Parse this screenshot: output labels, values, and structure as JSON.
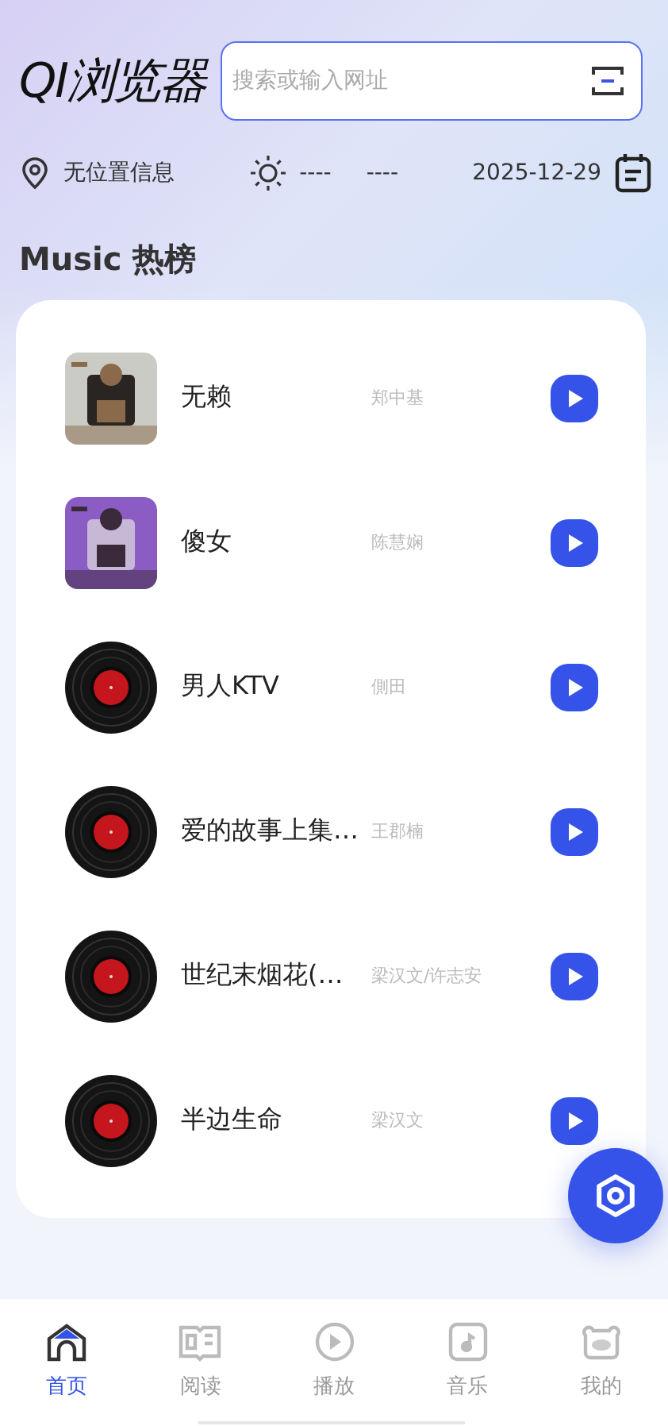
{
  "header": {
    "title": "QI浏览器",
    "search": {
      "placeholder": "搜索或输入网址"
    }
  },
  "info": {
    "location": "无位置信息",
    "weather": "----",
    "temperature": "----",
    "date": "2025-12-29"
  },
  "section_title": "Music 热榜",
  "songs": [
    {
      "title": "无赖",
      "artist": "郑中基",
      "kind": "picture"
    },
    {
      "title": "傻女",
      "artist": "陈慧娴",
      "kind": "picture"
    },
    {
      "title": "男人KTV",
      "artist": "側田",
      "kind": "disc"
    },
    {
      "title": "爱的故事上集…",
      "artist": "王郡楠",
      "kind": "disc"
    },
    {
      "title": "世纪末烟花(…",
      "artist": "梁汉文/许志安",
      "kind": "disc"
    },
    {
      "title": "半边生命",
      "artist": "梁汉文",
      "kind": "disc"
    }
  ],
  "tabs": [
    {
      "label": "首页",
      "selected": true
    },
    {
      "label": "阅读",
      "selected": false
    },
    {
      "label": "播放",
      "selected": false
    },
    {
      "label": "音乐",
      "selected": false
    },
    {
      "label": "我的",
      "selected": false
    }
  ]
}
